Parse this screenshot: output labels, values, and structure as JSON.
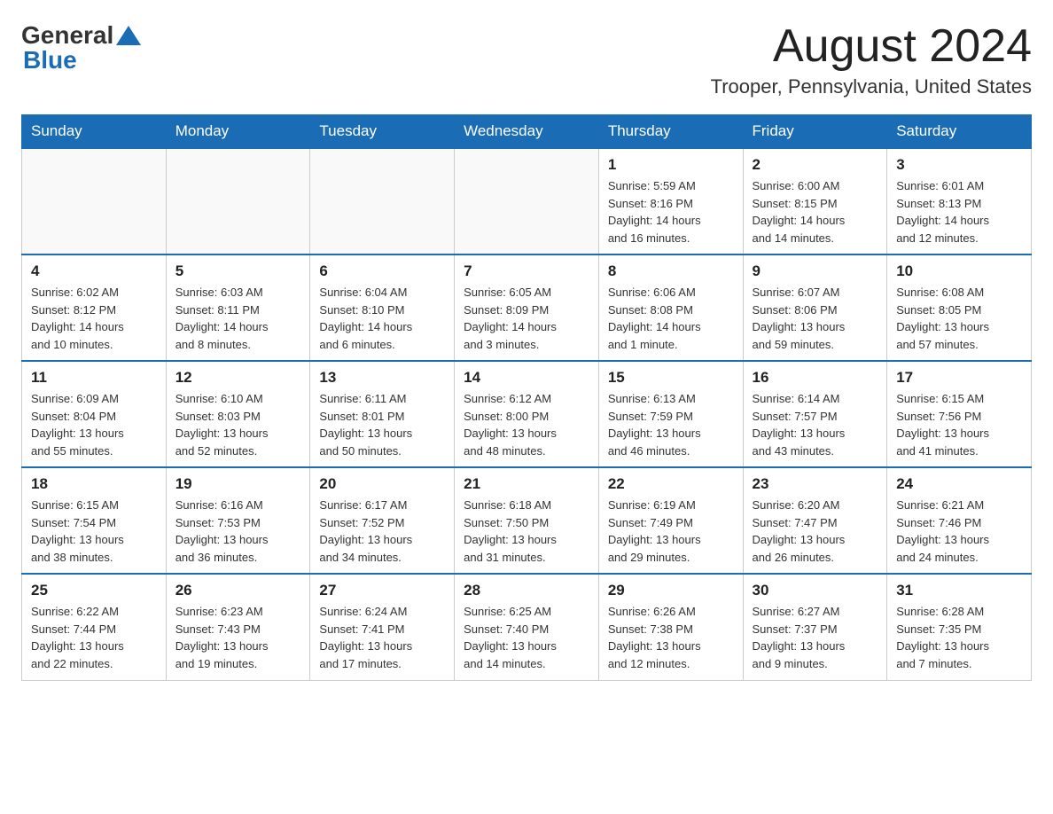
{
  "header": {
    "logo_general": "General",
    "logo_blue": "Blue",
    "month": "August 2024",
    "location": "Trooper, Pennsylvania, United States"
  },
  "days_of_week": [
    "Sunday",
    "Monday",
    "Tuesday",
    "Wednesday",
    "Thursday",
    "Friday",
    "Saturday"
  ],
  "weeks": [
    {
      "days": [
        {
          "num": "",
          "info": ""
        },
        {
          "num": "",
          "info": ""
        },
        {
          "num": "",
          "info": ""
        },
        {
          "num": "",
          "info": ""
        },
        {
          "num": "1",
          "info": "Sunrise: 5:59 AM\nSunset: 8:16 PM\nDaylight: 14 hours\nand 16 minutes."
        },
        {
          "num": "2",
          "info": "Sunrise: 6:00 AM\nSunset: 8:15 PM\nDaylight: 14 hours\nand 14 minutes."
        },
        {
          "num": "3",
          "info": "Sunrise: 6:01 AM\nSunset: 8:13 PM\nDaylight: 14 hours\nand 12 minutes."
        }
      ]
    },
    {
      "days": [
        {
          "num": "4",
          "info": "Sunrise: 6:02 AM\nSunset: 8:12 PM\nDaylight: 14 hours\nand 10 minutes."
        },
        {
          "num": "5",
          "info": "Sunrise: 6:03 AM\nSunset: 8:11 PM\nDaylight: 14 hours\nand 8 minutes."
        },
        {
          "num": "6",
          "info": "Sunrise: 6:04 AM\nSunset: 8:10 PM\nDaylight: 14 hours\nand 6 minutes."
        },
        {
          "num": "7",
          "info": "Sunrise: 6:05 AM\nSunset: 8:09 PM\nDaylight: 14 hours\nand 3 minutes."
        },
        {
          "num": "8",
          "info": "Sunrise: 6:06 AM\nSunset: 8:08 PM\nDaylight: 14 hours\nand 1 minute."
        },
        {
          "num": "9",
          "info": "Sunrise: 6:07 AM\nSunset: 8:06 PM\nDaylight: 13 hours\nand 59 minutes."
        },
        {
          "num": "10",
          "info": "Sunrise: 6:08 AM\nSunset: 8:05 PM\nDaylight: 13 hours\nand 57 minutes."
        }
      ]
    },
    {
      "days": [
        {
          "num": "11",
          "info": "Sunrise: 6:09 AM\nSunset: 8:04 PM\nDaylight: 13 hours\nand 55 minutes."
        },
        {
          "num": "12",
          "info": "Sunrise: 6:10 AM\nSunset: 8:03 PM\nDaylight: 13 hours\nand 52 minutes."
        },
        {
          "num": "13",
          "info": "Sunrise: 6:11 AM\nSunset: 8:01 PM\nDaylight: 13 hours\nand 50 minutes."
        },
        {
          "num": "14",
          "info": "Sunrise: 6:12 AM\nSunset: 8:00 PM\nDaylight: 13 hours\nand 48 minutes."
        },
        {
          "num": "15",
          "info": "Sunrise: 6:13 AM\nSunset: 7:59 PM\nDaylight: 13 hours\nand 46 minutes."
        },
        {
          "num": "16",
          "info": "Sunrise: 6:14 AM\nSunset: 7:57 PM\nDaylight: 13 hours\nand 43 minutes."
        },
        {
          "num": "17",
          "info": "Sunrise: 6:15 AM\nSunset: 7:56 PM\nDaylight: 13 hours\nand 41 minutes."
        }
      ]
    },
    {
      "days": [
        {
          "num": "18",
          "info": "Sunrise: 6:15 AM\nSunset: 7:54 PM\nDaylight: 13 hours\nand 38 minutes."
        },
        {
          "num": "19",
          "info": "Sunrise: 6:16 AM\nSunset: 7:53 PM\nDaylight: 13 hours\nand 36 minutes."
        },
        {
          "num": "20",
          "info": "Sunrise: 6:17 AM\nSunset: 7:52 PM\nDaylight: 13 hours\nand 34 minutes."
        },
        {
          "num": "21",
          "info": "Sunrise: 6:18 AM\nSunset: 7:50 PM\nDaylight: 13 hours\nand 31 minutes."
        },
        {
          "num": "22",
          "info": "Sunrise: 6:19 AM\nSunset: 7:49 PM\nDaylight: 13 hours\nand 29 minutes."
        },
        {
          "num": "23",
          "info": "Sunrise: 6:20 AM\nSunset: 7:47 PM\nDaylight: 13 hours\nand 26 minutes."
        },
        {
          "num": "24",
          "info": "Sunrise: 6:21 AM\nSunset: 7:46 PM\nDaylight: 13 hours\nand 24 minutes."
        }
      ]
    },
    {
      "days": [
        {
          "num": "25",
          "info": "Sunrise: 6:22 AM\nSunset: 7:44 PM\nDaylight: 13 hours\nand 22 minutes."
        },
        {
          "num": "26",
          "info": "Sunrise: 6:23 AM\nSunset: 7:43 PM\nDaylight: 13 hours\nand 19 minutes."
        },
        {
          "num": "27",
          "info": "Sunrise: 6:24 AM\nSunset: 7:41 PM\nDaylight: 13 hours\nand 17 minutes."
        },
        {
          "num": "28",
          "info": "Sunrise: 6:25 AM\nSunset: 7:40 PM\nDaylight: 13 hours\nand 14 minutes."
        },
        {
          "num": "29",
          "info": "Sunrise: 6:26 AM\nSunset: 7:38 PM\nDaylight: 13 hours\nand 12 minutes."
        },
        {
          "num": "30",
          "info": "Sunrise: 6:27 AM\nSunset: 7:37 PM\nDaylight: 13 hours\nand 9 minutes."
        },
        {
          "num": "31",
          "info": "Sunrise: 6:28 AM\nSunset: 7:35 PM\nDaylight: 13 hours\nand 7 minutes."
        }
      ]
    }
  ]
}
